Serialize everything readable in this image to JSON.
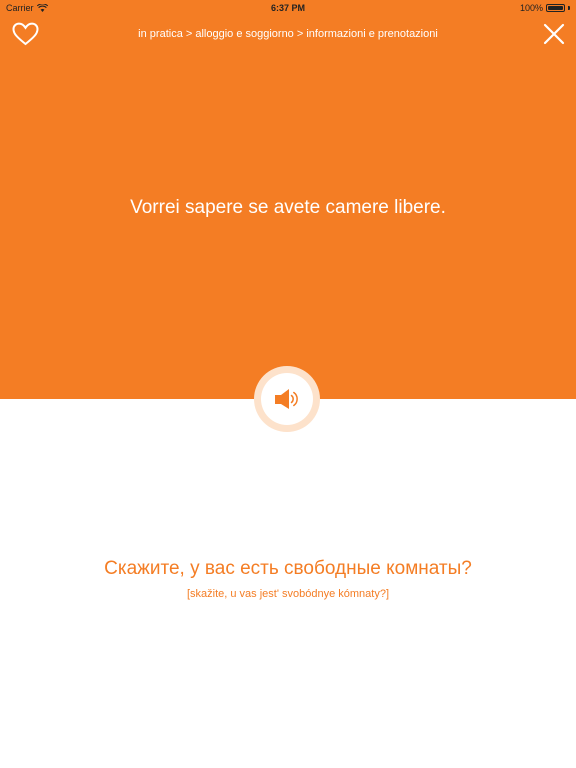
{
  "status_bar": {
    "carrier": "Carrier",
    "time": "6:37 PM",
    "battery": "100%",
    "icons": [
      "wifi-icon",
      "battery-icon"
    ]
  },
  "header": {
    "breadcrumb": "in pratica > alloggio e soggiorno > informazioni e prenotazioni",
    "favorite_icon": "heart-outline-icon",
    "close_icon": "close-x-icon"
  },
  "card": {
    "phrase": "Vorrei sapere se avete camere libere.",
    "audio_icon": "speaker-icon",
    "translation": "Скажите, у вас есть свободные комнаты?",
    "transliteration": "[skažite, u vas jest' svobódnye kómnaty?]"
  },
  "colors": {
    "accent": "#f47d24",
    "background": "#ffffff",
    "audio_ring": "#fde2cb"
  }
}
